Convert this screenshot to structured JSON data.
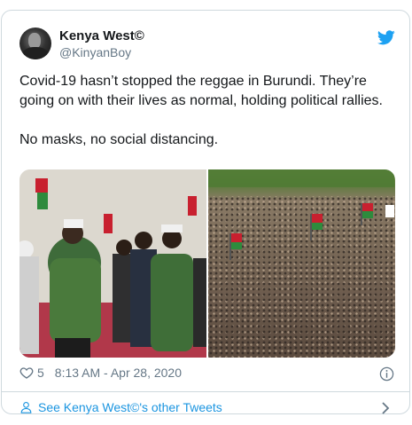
{
  "author": {
    "name": "Kenya West©",
    "handle": "@KinyanBoy"
  },
  "tweet": {
    "line1": "Covid-19 hasn’t stopped the reggae in Burundi. They’re going on with their lives as normal, holding political rallies.",
    "line2": "No masks, no social distancing."
  },
  "meta": {
    "likes": "5",
    "timestamp": "8:13 AM - Apr 28, 2020"
  },
  "footer": {
    "link_text": "See Kenya West©'s other Tweets"
  },
  "colors": {
    "link": "#1b95e0",
    "twitter_blue": "#1da1f2",
    "muted": "#657786",
    "border": "#cfd9de"
  },
  "icons": [
    "twitter-bird-icon",
    "heart-icon",
    "info-icon",
    "user-icon",
    "chevron-right-icon"
  ]
}
